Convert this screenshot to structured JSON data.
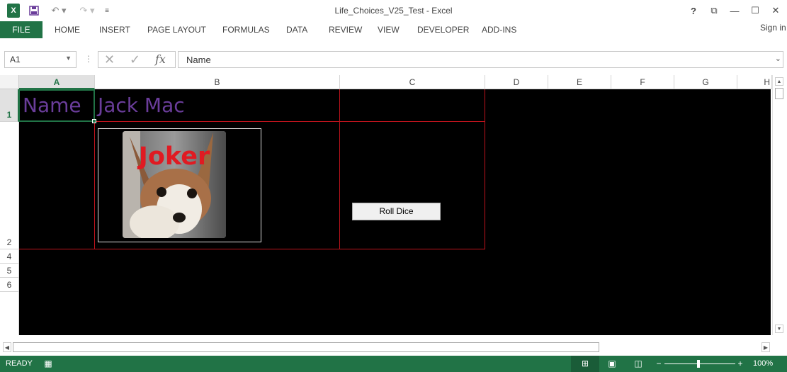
{
  "window": {
    "title": "Life_Choices_V25_Test - Excel",
    "help": "?",
    "restore": "⧉",
    "minimize": "—",
    "maximize": "☐",
    "close": "✕"
  },
  "qat": {
    "app_icon": "X",
    "undo": "↶ ▾",
    "redo": "↷ ▾",
    "customize": "≡"
  },
  "ribbon": {
    "file_tab": "FILE",
    "tabs": [
      "HOME",
      "INSERT",
      "PAGE LAYOUT",
      "FORMULAS",
      "DATA",
      "REVIEW",
      "VIEW",
      "DEVELOPER",
      "ADD-INS"
    ],
    "signin": "Sign in"
  },
  "formula_bar": {
    "name_box": "A1",
    "fx_label": "fx",
    "cancel": "✕",
    "enter": "✓",
    "value": "Name"
  },
  "grid": {
    "columns": [
      "A",
      "B",
      "C",
      "D",
      "E",
      "F",
      "G",
      "H"
    ],
    "active_column": "A",
    "rows": [
      "1",
      "2",
      "4",
      "5",
      "6"
    ],
    "active_row": "1"
  },
  "cells": {
    "a1": "Name",
    "b1": "Jack Mac"
  },
  "image": {
    "caption": "Joker"
  },
  "button": {
    "label": "Roll Dice"
  },
  "status": {
    "mode": "READY",
    "zoom": "100%",
    "zoom_minus": "−",
    "zoom_plus": "+"
  },
  "colors": {
    "accent": "#217346",
    "cell_text": "#6a3d9a",
    "border_red": "#c0141d"
  }
}
